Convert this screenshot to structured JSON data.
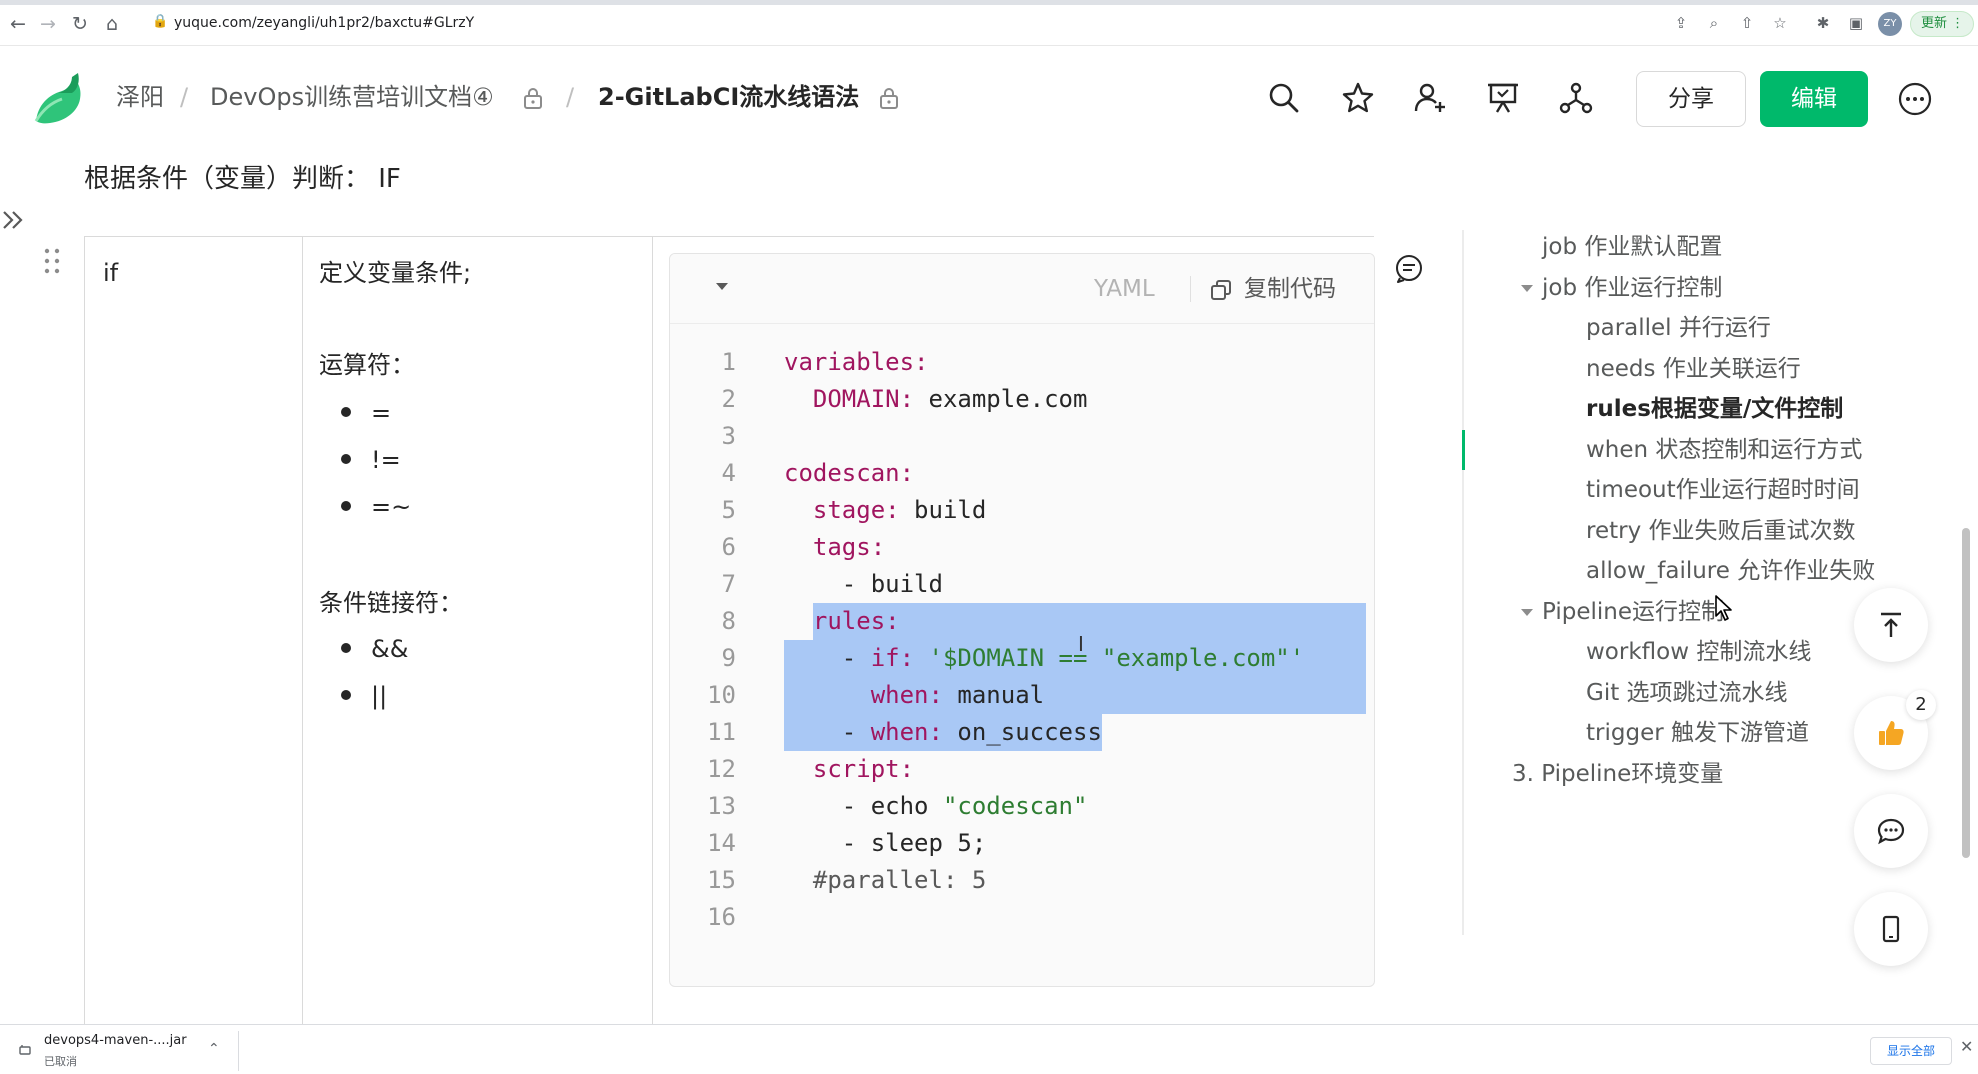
{
  "browser": {
    "url": "yuque.com/zeyangli/uh1pr2/baxctu#GLrzY",
    "profile_initials": "ZY",
    "update_label": "更新"
  },
  "header": {
    "breadcrumb": [
      {
        "label": "泽阳"
      },
      {
        "label": "DevOps训练营培训文档④"
      },
      {
        "label": "2-GitLabCI流水线语法"
      }
    ],
    "share_label": "分享",
    "edit_label": "编辑",
    "accent_color": "#00b96b"
  },
  "doc": {
    "heading": "根据条件（变量）判断： IF",
    "table": {
      "keyword": "if",
      "description": "定义变量条件;",
      "operators_title": "运算符：",
      "operators": [
        "=",
        "!=",
        "=~"
      ],
      "connectors_title": "条件链接符：",
      "connectors": [
        "&&",
        "||"
      ]
    }
  },
  "code_block": {
    "language": "YAML",
    "copy_label": "复制代码",
    "line_numbers": [
      "1",
      "2",
      "3",
      "4",
      "5",
      "6",
      "7",
      "8",
      "9",
      "10",
      "11",
      "12",
      "13",
      "14",
      "15",
      "16"
    ],
    "lines": [
      "variables:",
      "  DOMAIN: example.com",
      "",
      "codescan:",
      "  stage: build",
      "  tags:",
      "    - build",
      "  rules:",
      "    - if: '$DOMAIN == \"example.com\"'",
      "      when: manual",
      "    - when: on_success",
      "  script:",
      "    - echo \"codescan\"",
      "    - sleep 5;",
      "  #parallel: 5",
      ""
    ],
    "selected_lines": [
      8,
      9,
      10,
      11
    ]
  },
  "toc": {
    "items": [
      {
        "label": "job 作业默认配置",
        "level": 1
      },
      {
        "label": "job 作业运行控制",
        "level": 1,
        "expanded": true
      },
      {
        "label": "parallel 并行运行",
        "level": 2
      },
      {
        "label": "needs 作业关联运行",
        "level": 2
      },
      {
        "label": "rules根据变量/文件控制",
        "level": 2,
        "active": true
      },
      {
        "label": "when 状态控制和运行方式",
        "level": 2
      },
      {
        "label": "timeout作业运行超时时间",
        "level": 2
      },
      {
        "label": "retry 作业失败后重试次数",
        "level": 2
      },
      {
        "label": "allow_failure 允许作业失败",
        "level": 2
      },
      {
        "label": "Pipeline运行控制",
        "level": 1,
        "expanded": true
      },
      {
        "label": "workflow 控制流水线",
        "level": 2
      },
      {
        "label": "Git 选项跳过流水线",
        "level": 2
      },
      {
        "label": "trigger 触发下游管道",
        "level": 2
      },
      {
        "label": "3. Pipeline环境变量",
        "level": 0
      }
    ]
  },
  "floating": {
    "like_count": "2"
  },
  "download": {
    "file_name": "devops4-maven-....jar",
    "status": "已取消",
    "show_all_label": "显示全部"
  }
}
